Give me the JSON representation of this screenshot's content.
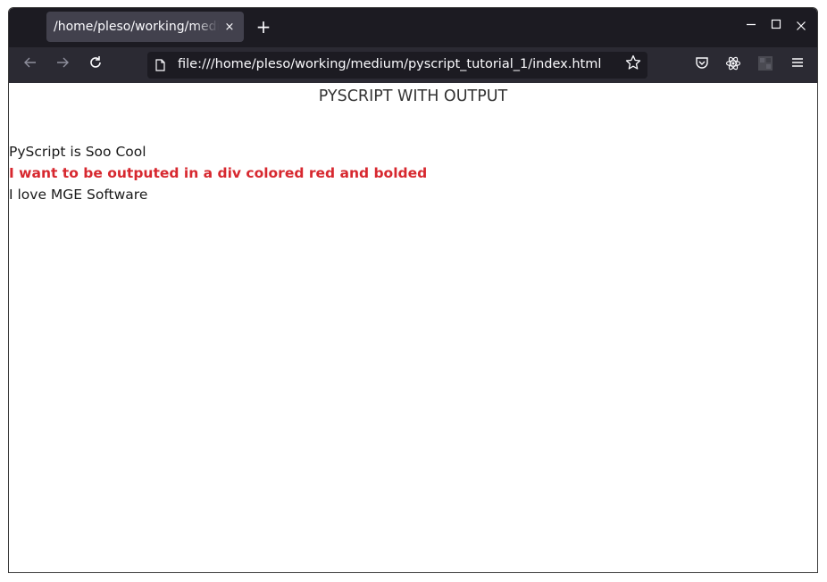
{
  "browser": {
    "tab_title": "/home/pleso/working/medium/pyscript_tutorial_1/index.html",
    "tab_close_glyph": "×",
    "new_tab_glyph": "+",
    "url": "file:///home/pleso/working/medium/pyscript_tutorial_1/index.html",
    "icons": {
      "back": "back-arrow-icon",
      "forward": "forward-arrow-icon",
      "reload": "reload-icon",
      "page": "page-icon",
      "bookmark": "star-icon",
      "pocket": "pocket-icon",
      "react": "react-devtools-icon",
      "extension": "extension-icon",
      "menu": "hamburger-menu-icon"
    }
  },
  "page": {
    "heading": "PYSCRIPT WITH OUTPUT",
    "lines": [
      "PyScript is Soo Cool",
      "I want to be outputed in a div colored red and bolded",
      "I love MGE Software"
    ],
    "highlight_color": "#d7282f"
  }
}
